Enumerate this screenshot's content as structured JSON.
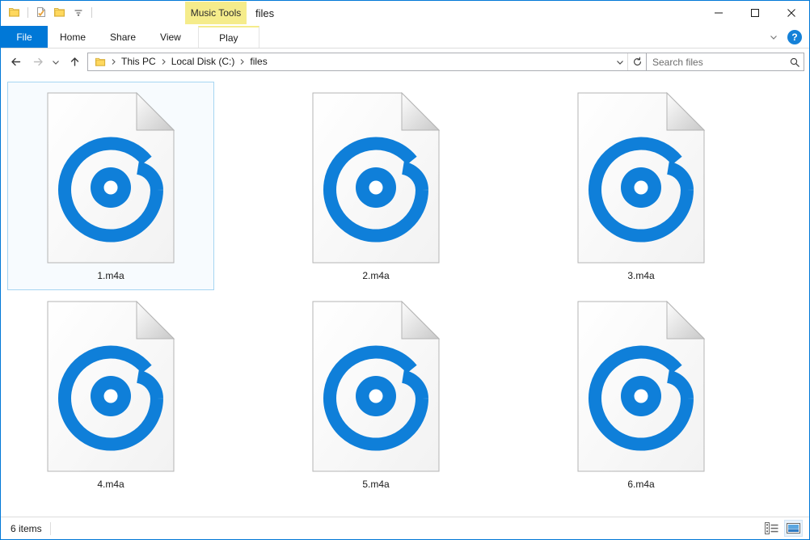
{
  "window": {
    "title": "files",
    "accent_color": "#0078d7",
    "border_color": "#0078d7"
  },
  "quick_access": {
    "items": [
      {
        "name": "folder-icon",
        "label": "Folder"
      },
      {
        "name": "properties-icon",
        "label": "Properties"
      },
      {
        "name": "new-folder-icon",
        "label": "New folder"
      },
      {
        "name": "customize-dropdown-icon",
        "label": "Customize Quick Access Toolbar"
      }
    ]
  },
  "contextual_tab": {
    "label": "Music Tools",
    "color": "#f5ec8b"
  },
  "window_controls": {
    "minimize": "Minimize",
    "maximize": "Maximize",
    "close": "Close"
  },
  "ribbon": {
    "tabs": [
      {
        "label": "File",
        "active": true
      },
      {
        "label": "Home",
        "active": false
      },
      {
        "label": "Share",
        "active": false
      },
      {
        "label": "View",
        "active": false
      },
      {
        "label": "Play",
        "active": false
      }
    ],
    "collapse_label": "Minimize the Ribbon",
    "help_label": "?"
  },
  "address_bar": {
    "back_label": "Back",
    "forward_label": "Forward",
    "recent_label": "Recent locations",
    "up_label": "Up",
    "breadcrumbs": [
      "This PC",
      "Local Disk (C:)",
      "files"
    ],
    "dropdown_label": "Previous locations",
    "refresh_label": "Refresh"
  },
  "search": {
    "placeholder": "Search files"
  },
  "files": [
    {
      "name": "1.m4a",
      "type": "m4a",
      "selected": true
    },
    {
      "name": "2.m4a",
      "type": "m4a",
      "selected": false
    },
    {
      "name": "3.m4a",
      "type": "m4a",
      "selected": false
    },
    {
      "name": "4.m4a",
      "type": "m4a",
      "selected": false
    },
    {
      "name": "5.m4a",
      "type": "m4a",
      "selected": false
    },
    {
      "name": "6.m4a",
      "type": "m4a",
      "selected": false
    }
  ],
  "file_icon": {
    "name": "music-file-icon",
    "glyph_color": "#0f7fd9",
    "page_color": "#fbfbfb"
  },
  "status_bar": {
    "item_count": "6 items",
    "views": [
      {
        "name": "details-view-icon",
        "label": "Details view",
        "active": false
      },
      {
        "name": "large-icons-view-icon",
        "label": "Large icons view",
        "active": true
      }
    ]
  }
}
